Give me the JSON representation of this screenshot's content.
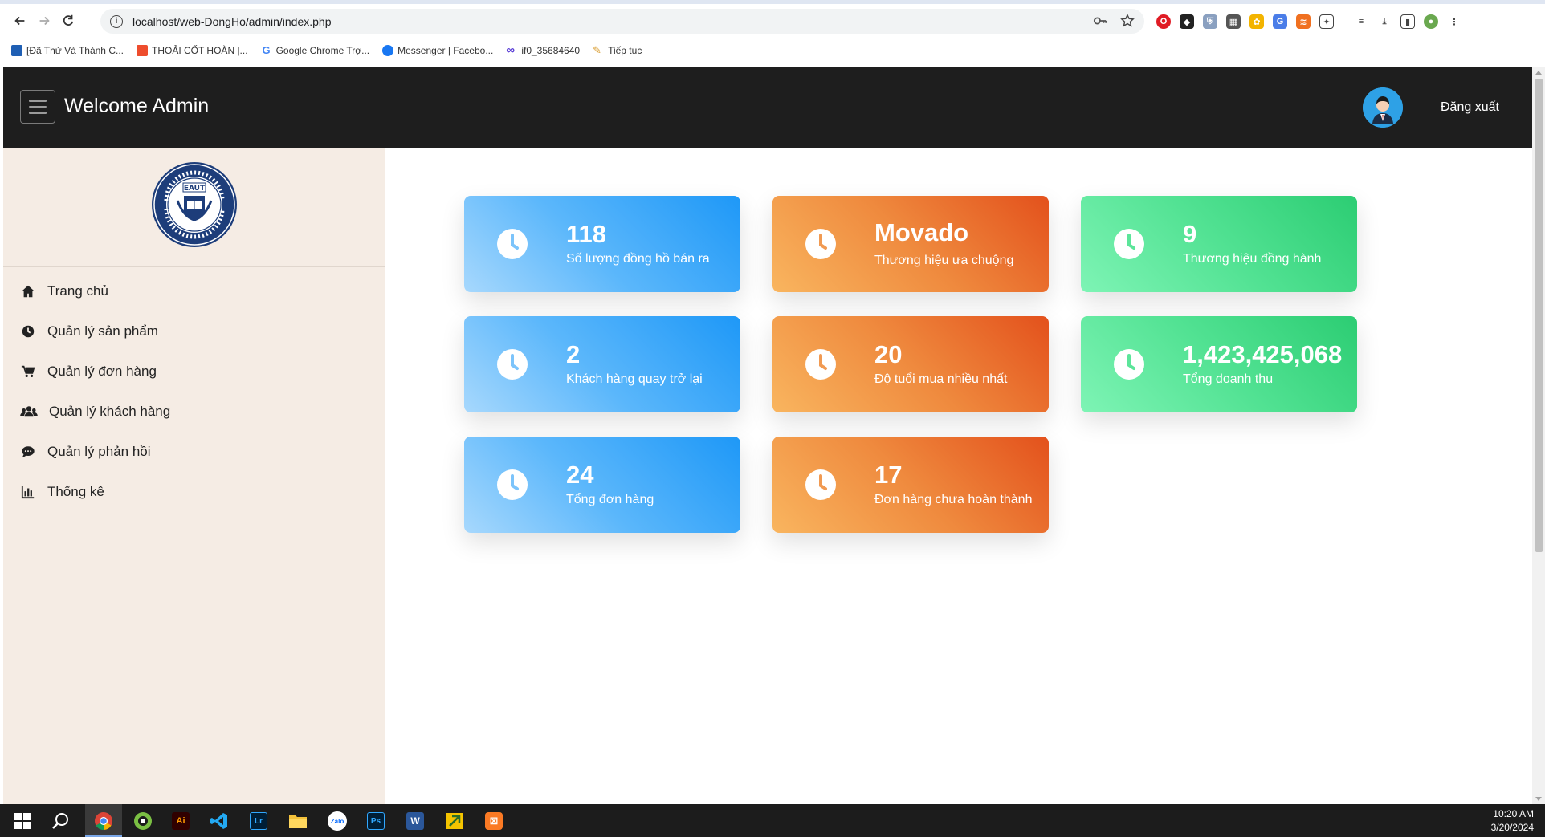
{
  "browser": {
    "url": "localhost/web-DongHo/admin/index.php",
    "bookmarks": [
      {
        "label": "[Đã Thử Và Thành C...",
        "icon": "bookmark-blue-icon",
        "color": "#1f5fb4"
      },
      {
        "label": "THOẢI CỐT HOÀN |...",
        "icon": "shopee-icon",
        "color": "#ee4d2d"
      },
      {
        "label": "Google Chrome Trợ...",
        "icon": "google-icon",
        "color": "#4285f4"
      },
      {
        "label": "Messenger | Facebo...",
        "icon": "facebook-icon",
        "color": "#1877f2"
      },
      {
        "label": "if0_35684640",
        "icon": "infinity-icon",
        "color": "#5b3fd6"
      },
      {
        "label": "Tiếp tục",
        "icon": "pen-icon",
        "color": "#d89a2a"
      }
    ]
  },
  "header": {
    "title": "Welcome Admin",
    "logout_label": "Đăng xuất"
  },
  "sidebar": {
    "logo_text": "EAUT",
    "items": [
      {
        "label": "Trang chủ",
        "icon": "home-icon"
      },
      {
        "label": "Quản lý sản phẩm",
        "icon": "clock-icon"
      },
      {
        "label": "Quản lý đơn hàng",
        "icon": "cart-icon"
      },
      {
        "label": "Quản lý khách hàng",
        "icon": "users-icon"
      },
      {
        "label": "Quản lý phản hồi",
        "icon": "comment-icon"
      },
      {
        "label": "Thống kê",
        "icon": "bar-chart-icon"
      }
    ]
  },
  "cards": [
    {
      "value": "118",
      "label": "Số lượng đồng hồ bán ra",
      "color": "blue"
    },
    {
      "value": "Movado",
      "label": "Thương hiệu ưa chuộng",
      "color": "orange"
    },
    {
      "value": "9",
      "label": "Thương hiệu đồng hành",
      "color": "green"
    },
    {
      "value": "2",
      "label": "Khách hàng quay trở lại",
      "color": "blue"
    },
    {
      "value": "20",
      "label": "Độ tuổi mua nhiều nhất",
      "color": "orange"
    },
    {
      "value": "1,423,425,068",
      "label": "Tổng doanh thu",
      "color": "green"
    },
    {
      "value": "24",
      "label": "Tổng đơn hàng",
      "color": "blue"
    },
    {
      "value": "17",
      "label": "Đơn hàng chưa hoàn thành",
      "color": "orange"
    }
  ],
  "colors": {
    "header_bg": "#1e1e1e",
    "sidebar_bg": "#f5ece4",
    "blue_card": "#1e98f7",
    "orange_card": "#e3511c",
    "green_card": "#2ccd73"
  },
  "taskbar": {
    "time": "10:20 AM",
    "date": "3/20/2024"
  }
}
